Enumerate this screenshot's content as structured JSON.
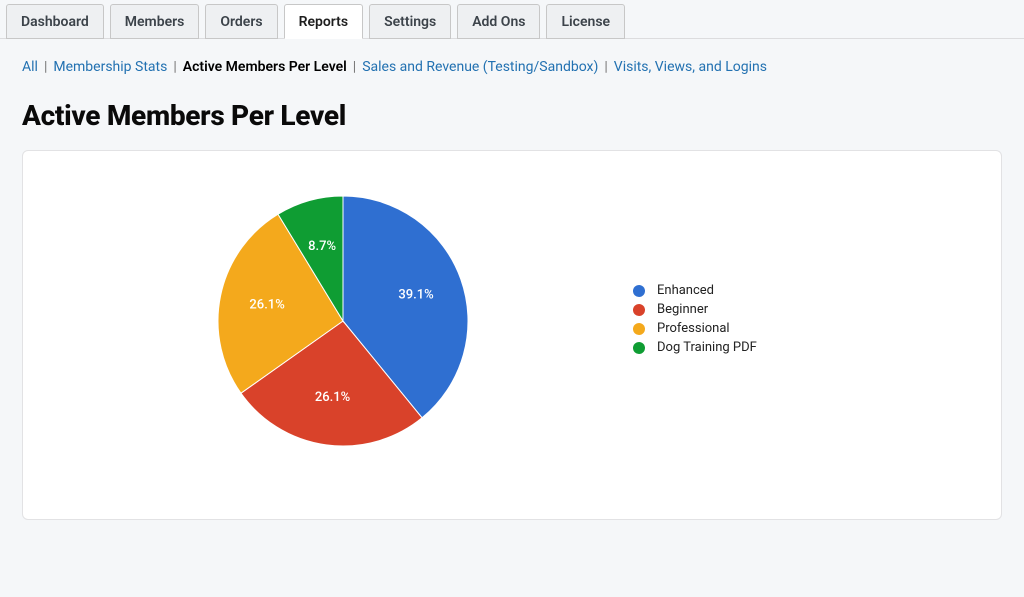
{
  "tabs": [
    {
      "label": "Dashboard",
      "active": false
    },
    {
      "label": "Members",
      "active": false
    },
    {
      "label": "Orders",
      "active": false
    },
    {
      "label": "Reports",
      "active": true
    },
    {
      "label": "Settings",
      "active": false
    },
    {
      "label": "Add Ons",
      "active": false
    },
    {
      "label": "License",
      "active": false
    }
  ],
  "subnav": {
    "items": [
      {
        "label": "All",
        "current": false
      },
      {
        "label": "Membership Stats",
        "current": false
      },
      {
        "label": "Active Members Per Level",
        "current": true
      },
      {
        "label": "Sales and Revenue (Testing/Sandbox)",
        "current": false
      },
      {
        "label": "Visits, Views, and Logins",
        "current": false
      }
    ]
  },
  "page_title": "Active Members Per Level",
  "chart_data": {
    "type": "pie",
    "title": "Active Members Per Level",
    "series": [
      {
        "name": "Enhanced",
        "value": 39.1,
        "label": "39.1%",
        "color": "#2f6fd1"
      },
      {
        "name": "Beginner",
        "value": 26.1,
        "label": "26.1%",
        "color": "#d9422a"
      },
      {
        "name": "Professional",
        "value": 26.1,
        "label": "26.1%",
        "color": "#f4a91c"
      },
      {
        "name": "Dog Training PDF",
        "value": 8.7,
        "label": "8.7%",
        "color": "#0f9d33"
      }
    ]
  }
}
